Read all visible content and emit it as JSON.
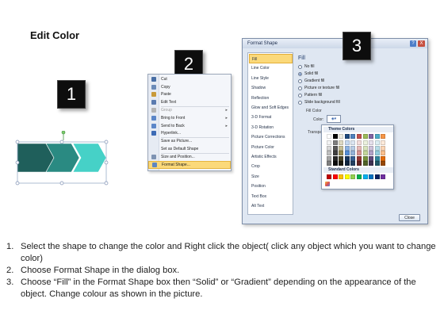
{
  "title": "Edit Color",
  "badges": [
    "1",
    "2",
    "3"
  ],
  "context_menu": {
    "items": [
      {
        "label": "Cut",
        "icon": "scissors-icon",
        "icon_color": "#4a6fa5",
        "disabled": false,
        "submenu": false
      },
      {
        "label": "Copy",
        "icon": "copy-icon",
        "icon_color": "#6b8bb8",
        "disabled": false,
        "submenu": false
      },
      {
        "label": "Paste",
        "icon": "paste-icon",
        "icon_color": "#c89a3a",
        "disabled": false,
        "submenu": false
      },
      {
        "label": "Edit Text",
        "icon": "text-icon",
        "icon_color": "#5a7bb0",
        "disabled": false,
        "submenu": false
      },
      {
        "label": "Group",
        "icon": "group-icon",
        "icon_color": "#b4b4b4",
        "disabled": true,
        "submenu": true
      },
      {
        "label": "Bring to Front",
        "icon": "bring-front-icon",
        "icon_color": "#5b86c8",
        "disabled": false,
        "submenu": true
      },
      {
        "label": "Send to Back",
        "icon": "send-back-icon",
        "icon_color": "#5b86c8",
        "disabled": false,
        "submenu": true
      },
      {
        "label": "Hyperlink...",
        "icon": "hyperlink-icon",
        "icon_color": "#3d6bb5",
        "disabled": false,
        "submenu": false
      },
      {
        "label": "Save as Picture...",
        "icon": "",
        "icon_color": "",
        "disabled": false,
        "submenu": false
      },
      {
        "label": "Set as Default Shape",
        "icon": "",
        "icon_color": "",
        "disabled": false,
        "submenu": false
      },
      {
        "label": "Size and Position...",
        "icon": "size-icon",
        "icon_color": "#7e93b3",
        "disabled": false,
        "submenu": false
      },
      {
        "label": "Format Shape...",
        "icon": "format-shape-icon",
        "icon_color": "#5f86c0",
        "disabled": false,
        "submenu": false,
        "highlight": true
      }
    ]
  },
  "dialog": {
    "title": "Format Shape",
    "help": "?",
    "close": "X",
    "nav": [
      "Fill",
      "Line Color",
      "Line Style",
      "Shadow",
      "Reflection",
      "Glow and Soft Edges",
      "3-D Format",
      "3-D Rotation",
      "Picture Corrections",
      "Picture Color",
      "Artistic Effects",
      "Crop",
      "Size",
      "Position",
      "Text Box",
      "Alt Text"
    ],
    "active_nav": "Fill",
    "panel_heading": "Fill",
    "fill_options": [
      "No fill",
      "Solid fill",
      "Gradient fill",
      "Picture or texture fill",
      "Pattern fill",
      "Slide background fill"
    ],
    "selected_fill": "Solid fill",
    "fill_color_label": "Fill Color",
    "color_label": "Color:",
    "transparency_label": "Transpa",
    "close_button": "Close"
  },
  "palette": {
    "theme_label": "Theme Colors",
    "standard_label": "Standard Colors",
    "theme_top": [
      "#ffffff",
      "#000000",
      "#eeece1",
      "#1f497d",
      "#4f81bd",
      "#c0504d",
      "#9bbb59",
      "#8064a2",
      "#4bacc6",
      "#f79646"
    ],
    "theme_shades": [
      [
        "#f2f2f2",
        "#7f7f7f",
        "#ddd9c3",
        "#c6d9f0",
        "#dbe5f1",
        "#f2dcdb",
        "#ebf1dd",
        "#e5e0ec",
        "#dbeef3",
        "#fdeada"
      ],
      [
        "#d8d8d8",
        "#595959",
        "#c4bd97",
        "#8db3e2",
        "#b8cce4",
        "#e5b9b7",
        "#d7e3bc",
        "#ccc1d9",
        "#b7dde8",
        "#fbd5b5"
      ],
      [
        "#bfbfbf",
        "#3f3f3f",
        "#938953",
        "#548dd4",
        "#95b3d7",
        "#d99694",
        "#c3d69b",
        "#b2a2c7",
        "#92cddc",
        "#fac08f"
      ],
      [
        "#a5a5a5",
        "#262626",
        "#494429",
        "#17365d",
        "#366092",
        "#953734",
        "#76923c",
        "#5f497a",
        "#31859b",
        "#e36c09"
      ],
      [
        "#7f7f7f",
        "#0c0c0c",
        "#1d1b10",
        "#0f243e",
        "#244061",
        "#632423",
        "#4f6128",
        "#3f3151",
        "#205867",
        "#974806"
      ]
    ],
    "standard": [
      "#c00000",
      "#ff0000",
      "#ffc000",
      "#ffff00",
      "#92d050",
      "#00b050",
      "#00b0f0",
      "#0070c0",
      "#002060",
      "#7030a0"
    ]
  },
  "shape_colors": {
    "dark": "#1f5f5b",
    "mid": "#2a8a82",
    "light": "#46d1c7"
  },
  "instructions": [
    {
      "num": "1.",
      "text": "Select the shape to change the color and Right click the object( click any object which you want to change color)"
    },
    {
      "num": "2.",
      "text": "Choose Format Shape in the dialog box."
    },
    {
      "num": "3.",
      "text": "Choose “Fill” in the Format Shape box then “Solid” or “Gradient” depending on the appearance of the object. Change colour as shown in the picture."
    }
  ]
}
